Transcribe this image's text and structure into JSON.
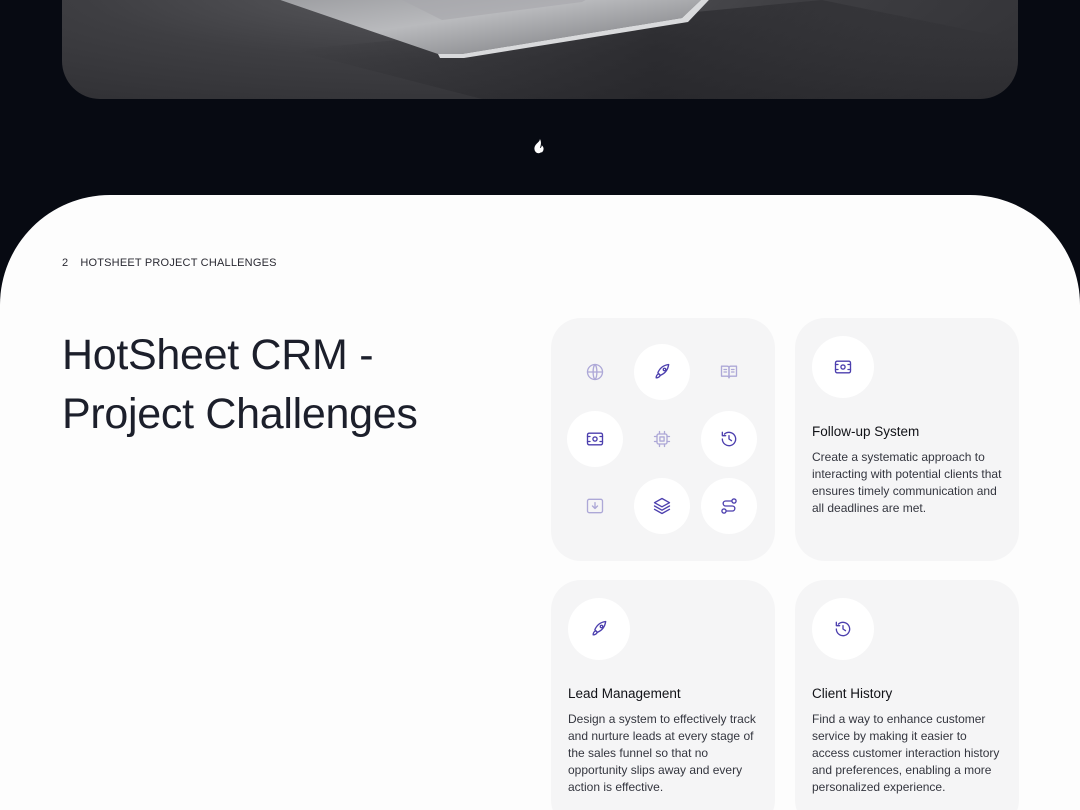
{
  "hero": {
    "image": "laptop-on-dark-surface"
  },
  "brand": {
    "icon": "flame-logo-icon"
  },
  "section": {
    "number": "2",
    "label": "HOTSHEET PROJECT CHALLENGES"
  },
  "title": "HotSheet CRM - Project Challenges",
  "colors": {
    "accent": "#4c3fae",
    "background": "#070a12",
    "card": "#f5f5f6"
  },
  "icon_grid": [
    {
      "icon": "globe-icon",
      "active": false
    },
    {
      "icon": "rocket-icon",
      "active": true
    },
    {
      "icon": "book-icon",
      "active": false
    },
    {
      "icon": "ticket-icon",
      "active": true
    },
    {
      "icon": "cpu-icon",
      "active": false
    },
    {
      "icon": "history-icon",
      "active": true
    },
    {
      "icon": "download-icon",
      "active": false
    },
    {
      "icon": "layers-icon",
      "active": true
    },
    {
      "icon": "route-icon",
      "active": true
    }
  ],
  "cards": {
    "followup": {
      "icon": "ticket-icon",
      "title": "Follow-up System",
      "description": "Create a systematic approach to interacting with potential clients that ensures timely communication and all deadlines are met."
    },
    "lead": {
      "icon": "rocket-icon",
      "title": "Lead Management",
      "description": "Design a system to effectively track and nurture leads at every stage of the sales funnel so that no opportunity slips away and every action is effective."
    },
    "history": {
      "icon": "history-icon",
      "title": "Client History",
      "description": "Find a way to enhance customer service by making it easier to access customer interaction history and preferences, enabling a more personalized experience."
    }
  }
}
